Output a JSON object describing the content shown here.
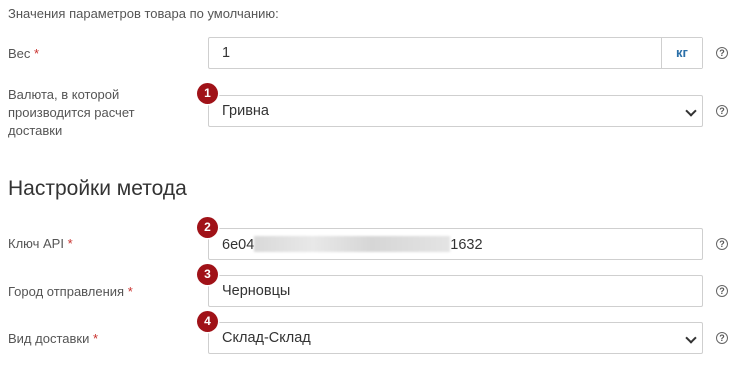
{
  "defaults_note": "Значения параметров товара по умолчанию:",
  "weight": {
    "label": "Вес",
    "required_mark": "*",
    "value": "1",
    "unit": "кг"
  },
  "currency": {
    "label": "Валюта, в которой производится расчет доставки",
    "value": "Гривна",
    "badge": "1"
  },
  "method_title": "Настройки метода",
  "api_key": {
    "label": "Ключ API",
    "required_mark": "*",
    "value_prefix": "6e04",
    "value_suffix": "1632",
    "badge": "2"
  },
  "city": {
    "label": "Город отправления",
    "required_mark": "*",
    "value": "Черновцы",
    "badge": "3"
  },
  "delivery_type": {
    "label": "Вид доставки",
    "required_mark": "*",
    "value": "Склад-Склад",
    "badge": "4"
  },
  "help_glyph": "?",
  "colors": {
    "badge": "#a01218",
    "required": "#c9302c",
    "unit": "#2a6fa8"
  },
  "icons": {
    "help": "question-circle-icon",
    "select": "chevron-down-icon"
  }
}
